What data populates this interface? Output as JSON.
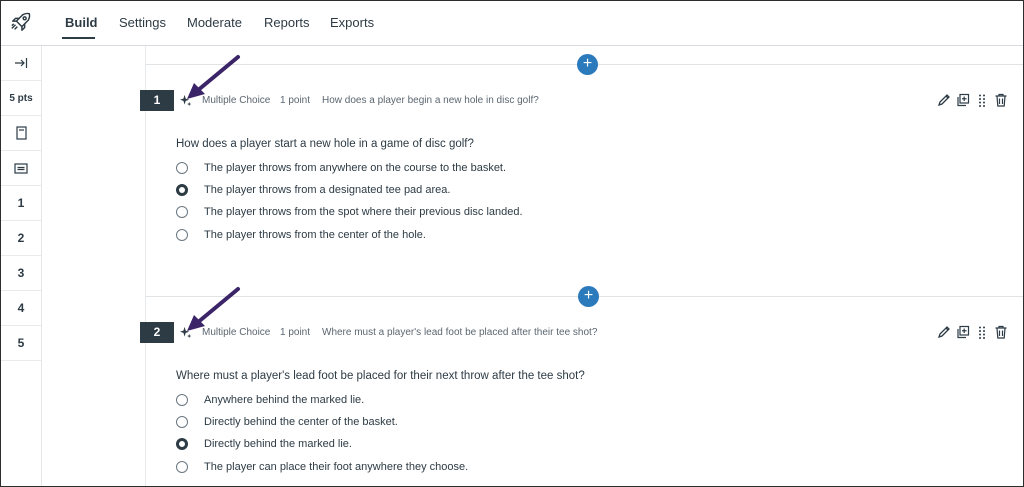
{
  "nav": {
    "tabs": [
      {
        "label": "Build",
        "active": true
      },
      {
        "label": "Settings",
        "active": false
      },
      {
        "label": "Moderate",
        "active": false
      },
      {
        "label": "Reports",
        "active": false
      },
      {
        "label": "Exports",
        "active": false
      }
    ]
  },
  "sidebar": {
    "points": "5 pts",
    "question_numbers": [
      "1",
      "2",
      "3",
      "4",
      "5"
    ]
  },
  "questions": [
    {
      "number": "1",
      "type": "Multiple Choice",
      "points": "1 point",
      "title": "How does a player begin a new hole in disc golf?",
      "stem": "How does a player start a new hole in a game of disc golf?",
      "options": [
        {
          "label": "The player throws from anywhere on the course to the basket.",
          "selected": false
        },
        {
          "label": "The player throws from a designated tee pad area.",
          "selected": true
        },
        {
          "label": "The player throws from the spot where their previous disc landed.",
          "selected": false
        },
        {
          "label": "The player throws from the center of the hole.",
          "selected": false
        }
      ]
    },
    {
      "number": "2",
      "type": "Multiple Choice",
      "points": "1 point",
      "title": "Where must a player's lead foot be placed after their tee shot?",
      "stem": "Where must a player's lead foot be placed for their next throw after the tee shot?",
      "options": [
        {
          "label": "Anywhere behind the marked lie.",
          "selected": false
        },
        {
          "label": "Directly behind the center of the basket.",
          "selected": false
        },
        {
          "label": "Directly behind the marked lie.",
          "selected": true
        },
        {
          "label": "The player can place their foot anywhere they choose.",
          "selected": false
        }
      ]
    }
  ],
  "colors": {
    "accent": "#2b7abc",
    "dark": "#2d3b45",
    "arrow": "#3b2468"
  },
  "icons": [
    "rocket-icon",
    "collapse-icon",
    "page-icon",
    "card-icon",
    "sparkle-icon",
    "pencil-icon",
    "duplicate-icon",
    "drag-handle-icon",
    "trash-icon",
    "plus-icon"
  ]
}
